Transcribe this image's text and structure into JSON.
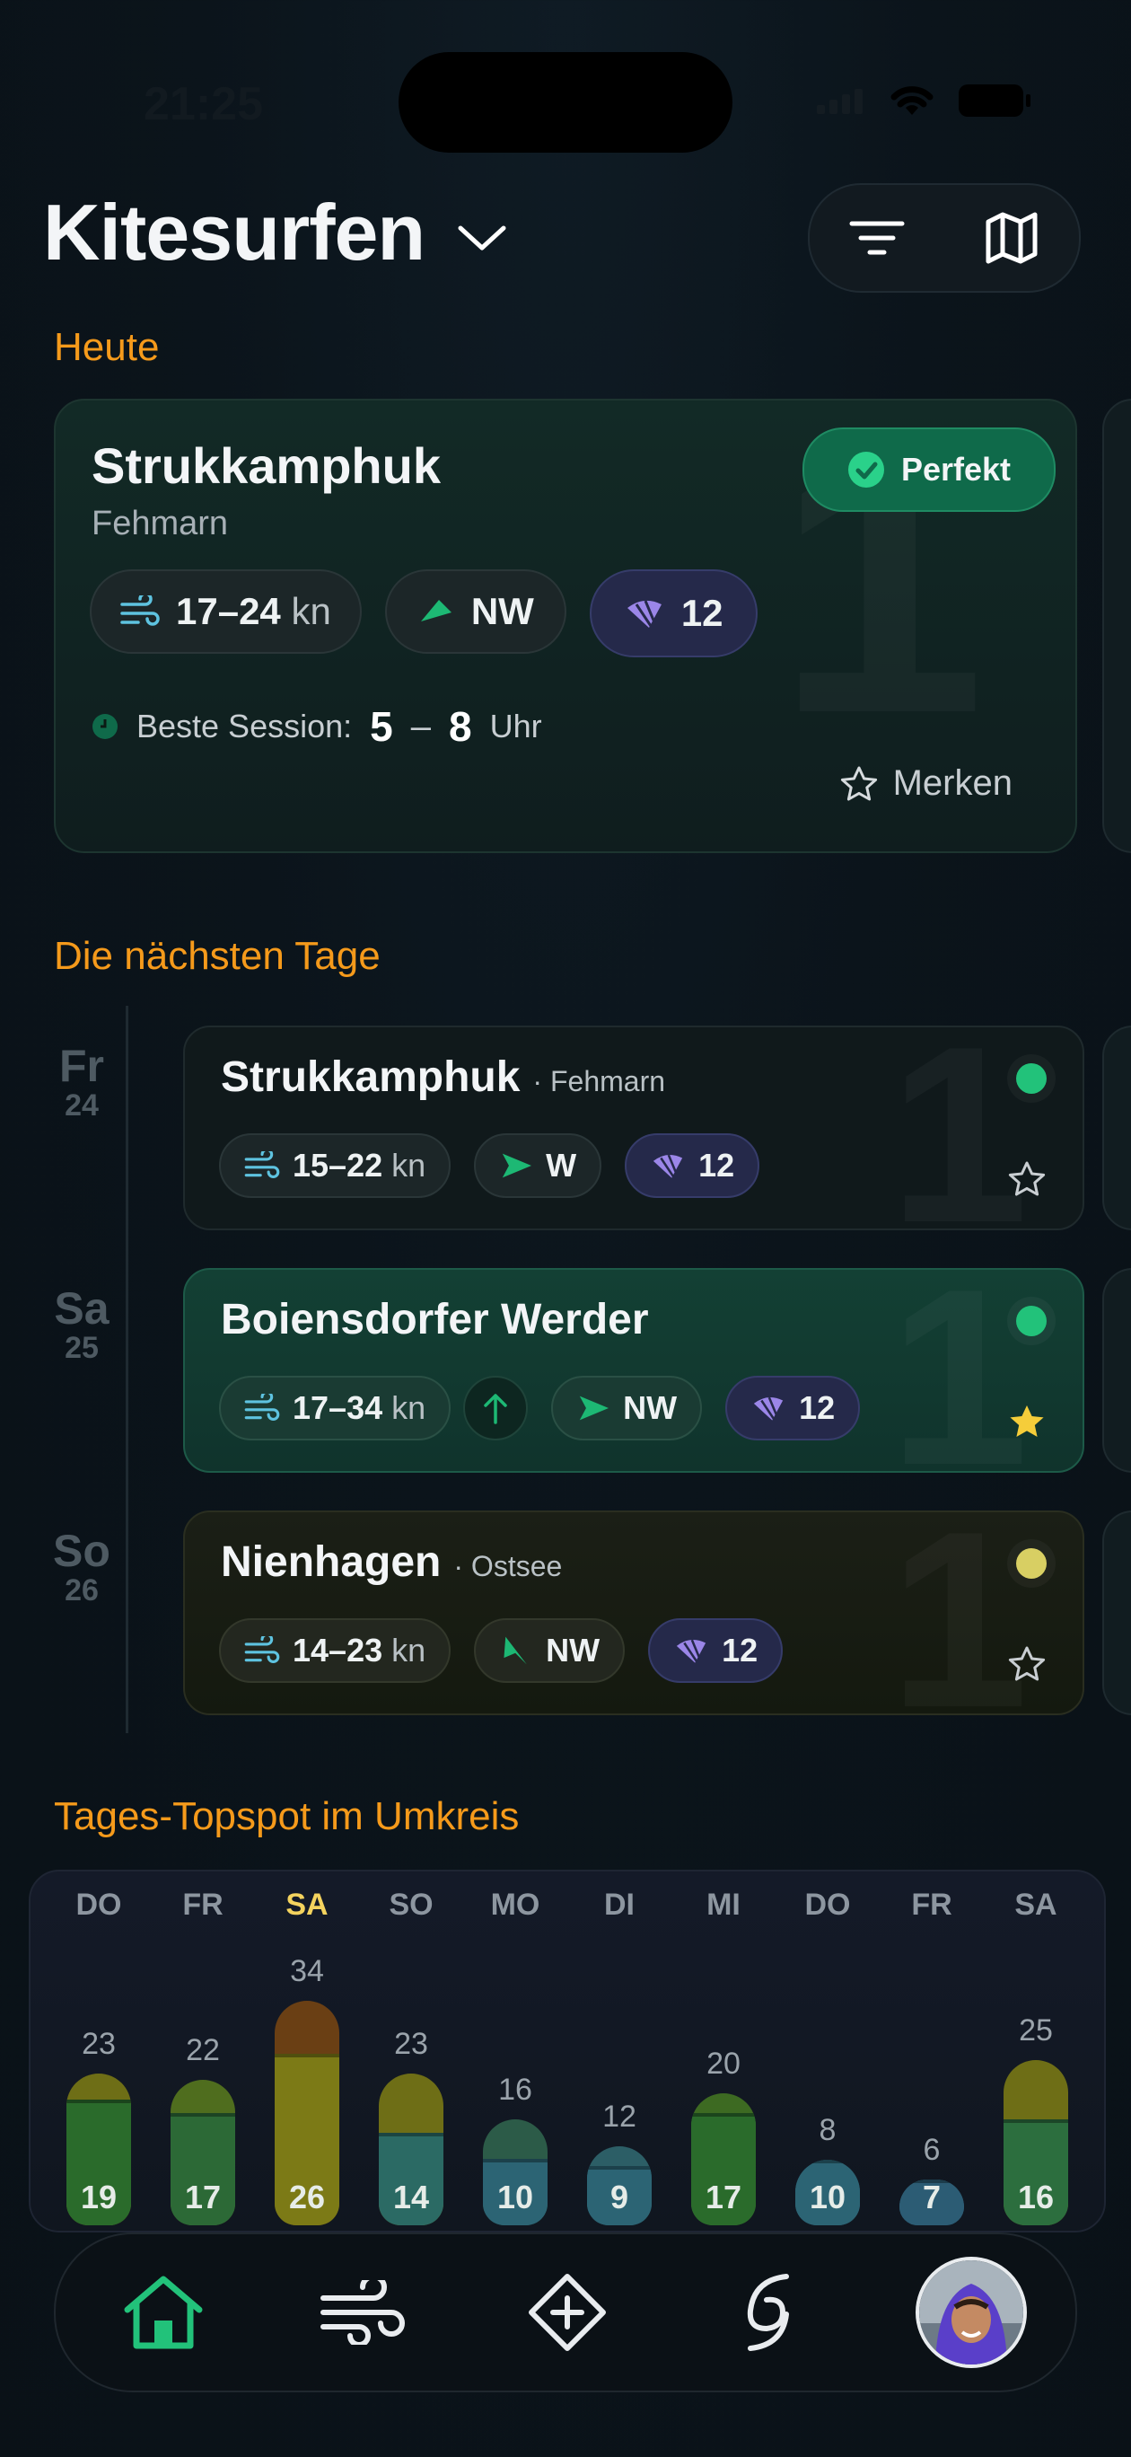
{
  "status": {
    "time": "21:25"
  },
  "header": {
    "title": "Kitesurfen"
  },
  "today": {
    "section": "Heute",
    "spot": "Strukkamphuk",
    "region": "Fehmarn",
    "rating": "Perfekt",
    "wind": "17–24",
    "wind_unit": "kn",
    "direction": "NW",
    "kite": "12",
    "session_label": "Beste Session:",
    "session_from": "5",
    "session_dash": "–",
    "session_to": "8",
    "session_unit": "Uhr",
    "save": "Merken",
    "rank": "1"
  },
  "next_days": {
    "section": "Die nächsten Tage",
    "items": [
      {
        "day": "Fr",
        "date": "24",
        "spot": "Strukkamphuk",
        "region": "· Fehmarn",
        "wind": "15–22",
        "unit": "kn",
        "direction": "W",
        "kite": "12",
        "status_color": "#22c27a",
        "starred": false,
        "rank": "1"
      },
      {
        "day": "Sa",
        "date": "25",
        "spot": "Boiensdorfer Werder",
        "region": "",
        "wind": "17–34",
        "unit": "kn",
        "direction": "NW",
        "kite": "12",
        "status_color": "#22c27a",
        "starred": true,
        "rank": "1"
      },
      {
        "day": "So",
        "date": "26",
        "spot": "Nienhagen",
        "region": "· Ostsee",
        "wind": "14–23",
        "unit": "kn",
        "direction": "NW",
        "kite": "12",
        "status_color": "#d8cf63",
        "starred": false,
        "rank": "1"
      }
    ]
  },
  "chart_data": {
    "type": "bar",
    "title": "Tages-Topspot im Umkreis",
    "categories": [
      "DO",
      "FR",
      "SA",
      "SO",
      "MO",
      "DI",
      "MI",
      "DO",
      "FR",
      "SA"
    ],
    "highlight_category_index": 2,
    "series": [
      {
        "values": [
          19,
          17,
          26,
          14,
          10,
          9,
          17,
          10,
          7,
          16
        ]
      },
      {
        "values": [
          23,
          22,
          34,
          23,
          16,
          12,
          20,
          8,
          6,
          25
        ]
      }
    ],
    "colors": {
      "bottom": [
        "#2a6b2b",
        "#2c6936",
        "#7c7a16",
        "#2b6a64",
        "#2c6474",
        "#2c6474",
        "#2a6b2b",
        "#2c6474",
        "#2c5c74",
        "#2c6e3e"
      ],
      "top": [
        "#6e6e16",
        "#4f6d1e",
        "#6a3f14",
        "#6e6e16",
        "#2c5b48",
        "#2c5e66",
        "#3d6a22",
        "#2c5e74",
        "#2c5c74",
        "#6e6e16"
      ]
    }
  },
  "nav": {
    "items": [
      "home-icon",
      "wind-icon",
      "add-spot-icon",
      "storm-icon",
      "avatar"
    ]
  }
}
